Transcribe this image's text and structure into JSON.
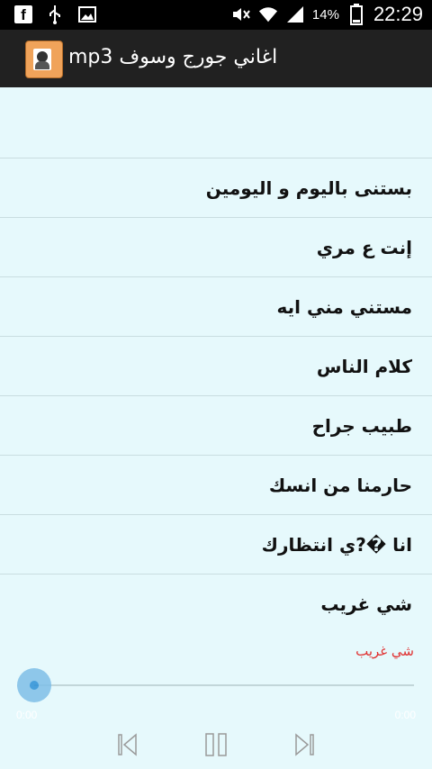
{
  "status_bar": {
    "battery_percent": "14%",
    "time": "22:29",
    "icons": [
      "facebook-icon",
      "usb-icon",
      "image-icon",
      "mute-icon",
      "wifi-icon",
      "signal-icon",
      "battery-icon"
    ]
  },
  "action_bar": {
    "title": "اغاني جورج وسوف mp3",
    "icon": "app-logo-icon"
  },
  "playlist": {
    "items": [
      "بستنى باليوم و اليومين",
      "إنت ع مري",
      "مستني مني ايه",
      "كلام الناس",
      "طبيب جراح",
      "حارمنا من انسك",
      "انا �?ي انتظارك",
      "شي غريب"
    ]
  },
  "player": {
    "now_playing": "شي غريب",
    "progress_fraction": 0.0,
    "elapsed": "0:00",
    "remaining": "0:00",
    "accent_color": "#2b8fd6",
    "now_playing_color": "#e03030"
  },
  "controls": {
    "prev_icon": "skip-previous-icon",
    "pause_icon": "pause-icon",
    "next_icon": "skip-next-icon"
  }
}
